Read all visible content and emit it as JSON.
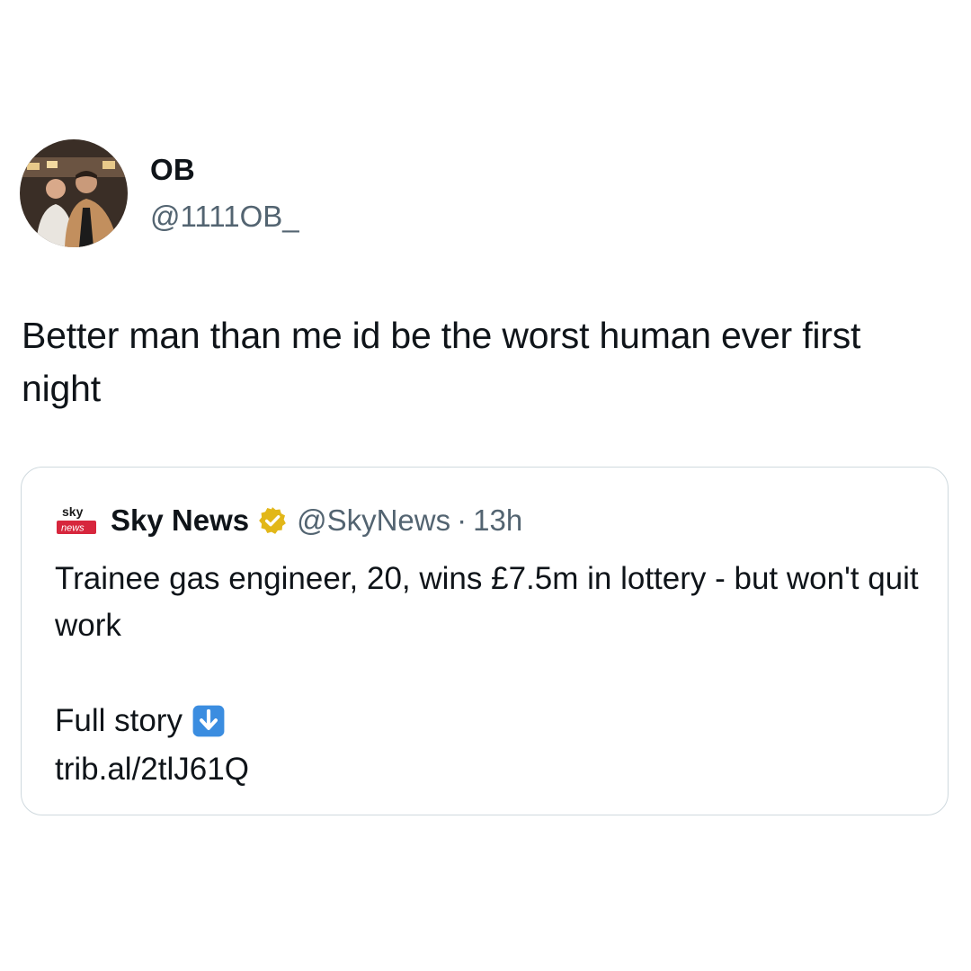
{
  "author": {
    "display_name": "OB",
    "handle": "@1111OB_",
    "avatar_icon": "profile-photo"
  },
  "tweet": {
    "text": "Better man than me id be the worst human ever first night"
  },
  "quoted_tweet": {
    "source_logo": {
      "icon": "sky-news-logo",
      "top_text": "sky",
      "bottom_text": "news",
      "colors": {
        "red": "#d7263d",
        "dark": "#1a1a1a"
      }
    },
    "display_name": "Sky News",
    "verified_icon": "verified-badge-gold",
    "handle": "@SkyNews",
    "separator": "·",
    "time": "13h",
    "text": "Trainee gas engineer, 20, wins £7.5m in lottery - but won't quit work",
    "cta_text": "Full story",
    "cta_icon": "down-arrow-emoji",
    "link": "trib.al/2tlJ61Q"
  },
  "colors": {
    "text_primary": "#0f1419",
    "text_secondary": "#536471",
    "border": "#cfd9de",
    "verified_gold": "#e2b719",
    "arrow_blue": "#3b8de0"
  }
}
